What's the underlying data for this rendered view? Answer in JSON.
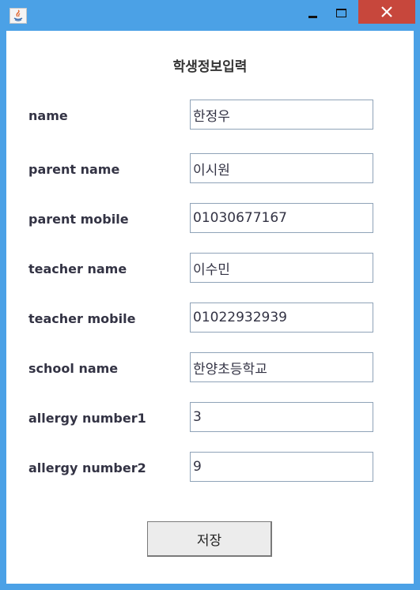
{
  "window": {
    "app_icon": "java-icon",
    "controls": {
      "minimize_icon": "minimize-icon",
      "maximize_icon": "maximize-icon",
      "close_icon": "close-icon"
    },
    "colors": {
      "frame": "#4ba1e6",
      "close": "#c7473c"
    }
  },
  "form": {
    "title": "학생정보입력",
    "fields": [
      {
        "label": "name",
        "value": "한정우"
      },
      {
        "label": "parent name",
        "value": "이시원"
      },
      {
        "label": "parent mobile",
        "value": "01030677167"
      },
      {
        "label": "teacher name",
        "value": "이수민"
      },
      {
        "label": "teacher mobile",
        "value": "01022932939"
      },
      {
        "label": "school name",
        "value": "한양초등학교"
      },
      {
        "label": "allergy number1",
        "value": "3"
      },
      {
        "label": "allergy number2",
        "value": "9"
      }
    ],
    "save_label": "저장"
  }
}
